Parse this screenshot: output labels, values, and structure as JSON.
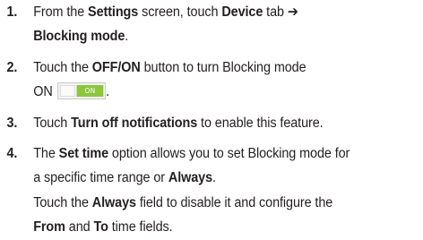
{
  "steps": [
    {
      "number": "1.",
      "lines": [
        [
          {
            "t": "From the ",
            "b": false
          },
          {
            "t": "Settings",
            "b": true
          },
          {
            "t": " screen, touch ",
            "b": false
          },
          {
            "t": "Device",
            "b": true
          },
          {
            "t": " tab ➔",
            "b": false
          }
        ],
        [
          {
            "t": "Blocking mode",
            "b": true
          },
          {
            "t": ".",
            "b": false
          }
        ]
      ]
    },
    {
      "number": "2.",
      "lines": [
        [
          {
            "t": "Touch the ",
            "b": false
          },
          {
            "t": "OFF/ON",
            "b": true
          },
          {
            "t": " button to turn Blocking mode",
            "b": false
          }
        ],
        [
          {
            "t": "ON",
            "b": false
          },
          {
            "toggle": "ON"
          },
          {
            "t": ".",
            "b": false
          }
        ]
      ]
    },
    {
      "number": "3.",
      "lines": [
        [
          {
            "t": "Touch ",
            "b": false
          },
          {
            "t": "Turn off notifications",
            "b": true
          },
          {
            "t": " to enable this feature.",
            "b": false
          }
        ]
      ]
    },
    {
      "number": "4.",
      "lines": [
        [
          {
            "t": "The ",
            "b": false
          },
          {
            "t": "Set time",
            "b": true
          },
          {
            "t": " option allows you to set Blocking mode for",
            "b": false
          }
        ],
        [
          {
            "t": "a specific time range or ",
            "b": false
          },
          {
            "t": "Always",
            "b": true
          },
          {
            "t": ".",
            "b": false
          }
        ],
        [
          {
            "t": "Touch the ",
            "b": false
          },
          {
            "t": "Always",
            "b": true
          },
          {
            "t": " field to disable it and configure the",
            "b": false
          }
        ],
        [
          {
            "t": "From",
            "b": true
          },
          {
            "t": " and ",
            "b": false
          },
          {
            "t": "To",
            "b": true
          },
          {
            "t": " time fields.",
            "b": false
          }
        ]
      ]
    }
  ],
  "colors": {
    "text": "#231f20",
    "toggle_on": "#8cc63f"
  }
}
